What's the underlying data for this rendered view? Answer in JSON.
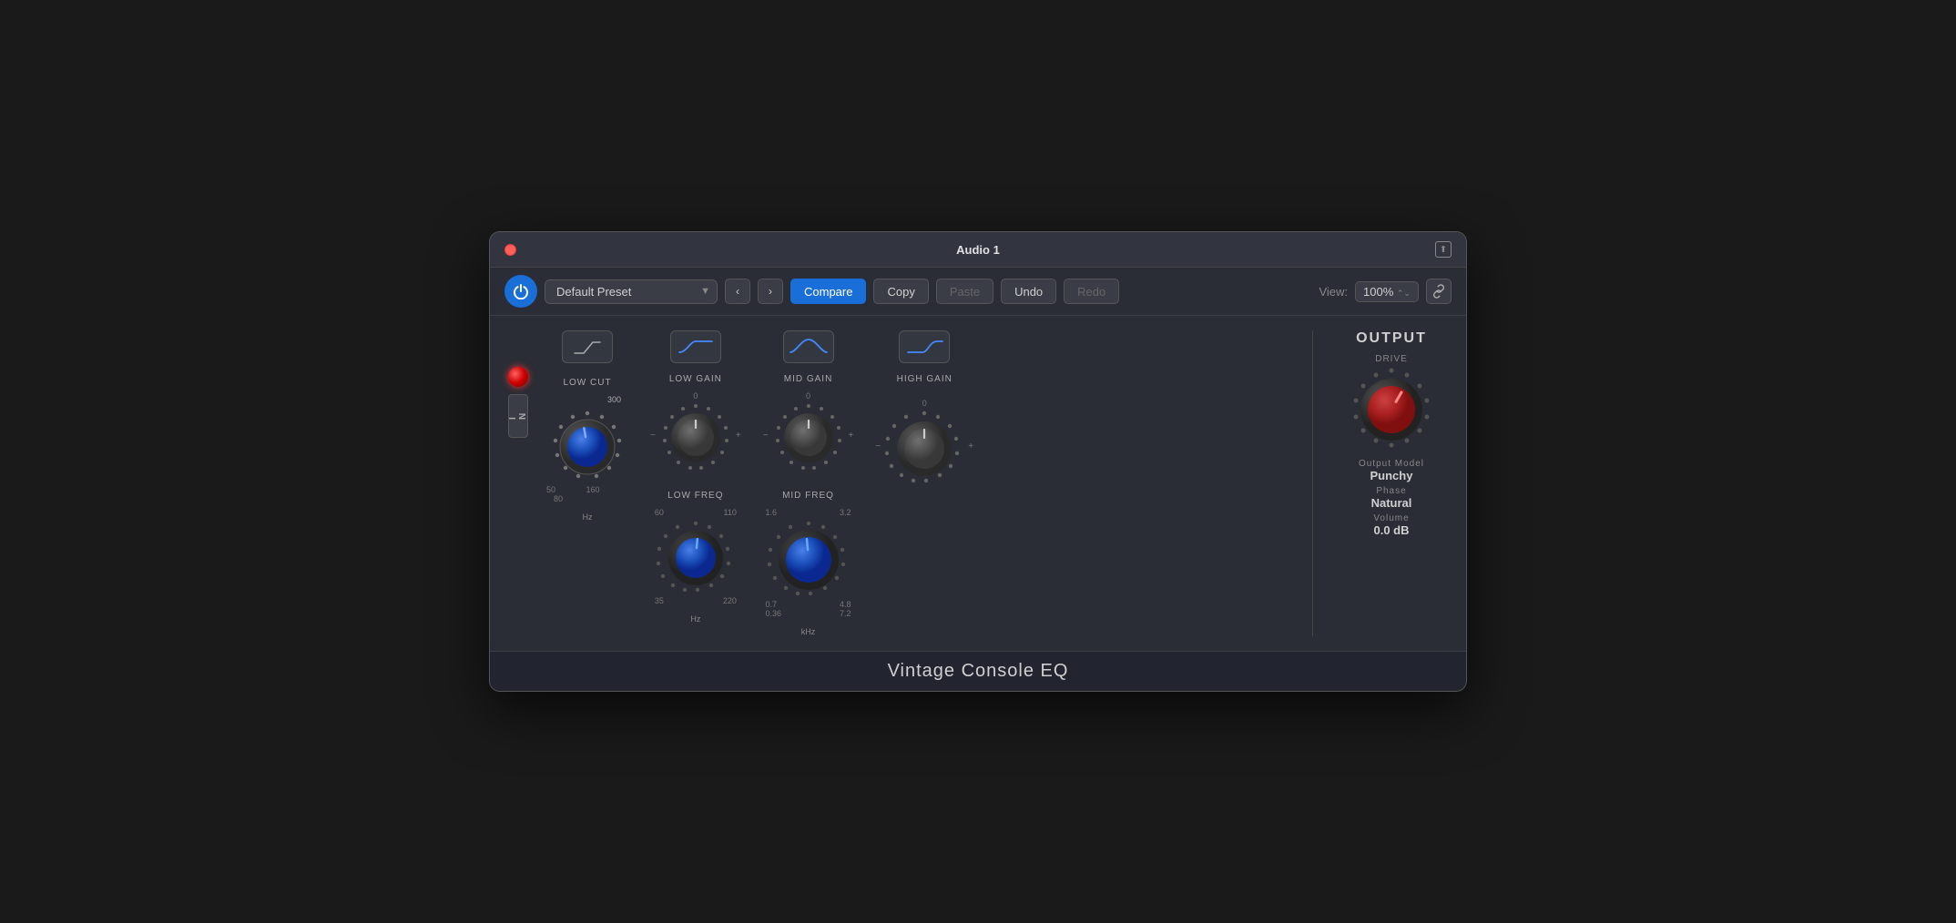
{
  "window": {
    "title": "Audio 1",
    "plugin_name": "Vintage Console EQ"
  },
  "toolbar": {
    "preset": "Default Preset",
    "compare_label": "Compare",
    "copy_label": "Copy",
    "paste_label": "Paste",
    "undo_label": "Undo",
    "redo_label": "Redo",
    "view_label": "View:",
    "view_value": "100%",
    "back_icon": "‹",
    "forward_icon": "›"
  },
  "bands": {
    "low_cut": {
      "label": "LOW CUT",
      "value": 300,
      "unit": "Hz",
      "marks": [
        "50",
        "80",
        "160",
        "300"
      ]
    },
    "low_gain": {
      "label": "LOW GAIN",
      "freq_label": "LOW FREQ",
      "gain_marks": [
        "-",
        "0",
        "+"
      ],
      "freq_marks": [
        "35",
        "60",
        "110",
        "220"
      ],
      "freq_unit": "Hz"
    },
    "mid_gain": {
      "label": "MID GAIN",
      "freq_label": "MID FREQ",
      "gain_marks": [
        "-",
        "0",
        "+"
      ],
      "freq_marks": [
        "0.36",
        "0.7",
        "1.6",
        "3.2",
        "4.8",
        "7.2"
      ],
      "freq_unit": "kHz"
    },
    "high_gain": {
      "label": "HIGH GAIN",
      "gain_marks": [
        "-",
        "0",
        "+"
      ]
    }
  },
  "output": {
    "title": "OUTPUT",
    "drive_label": "DRIVE",
    "output_model_label": "Output Model",
    "output_model_value": "Punchy",
    "phase_label": "Phase",
    "phase_value": "Natural",
    "volume_label": "Volume",
    "volume_value": "0.0 dB"
  },
  "icons": {
    "power": "⏻",
    "link": "🔗",
    "low_cut_shape": "shelf",
    "low_shelf": "low_shelf",
    "bell": "bell",
    "high_shelf": "high_shelf"
  }
}
